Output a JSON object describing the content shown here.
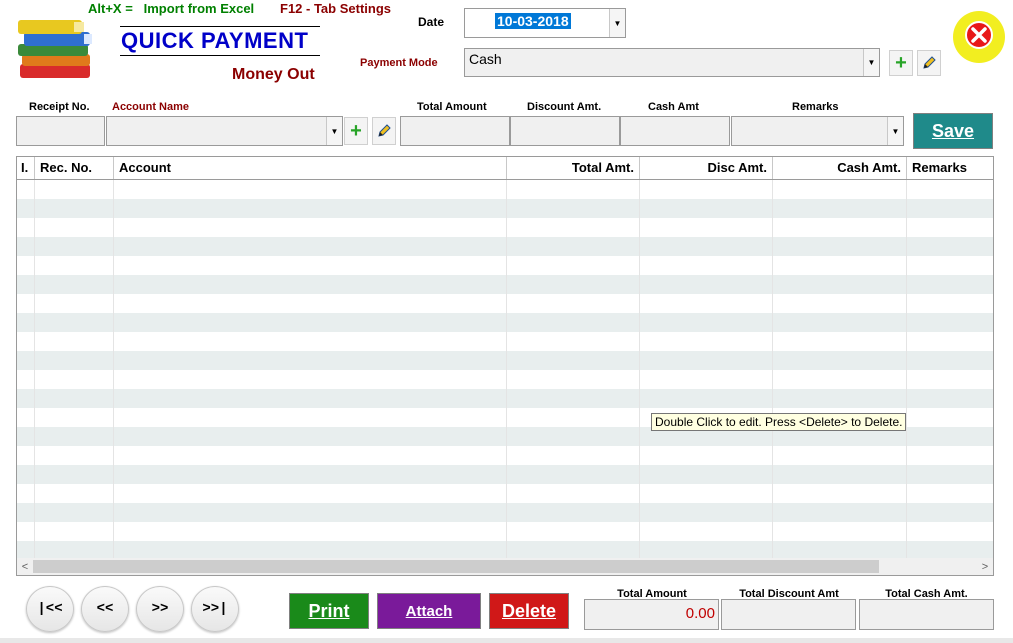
{
  "header": {
    "shortcut_excel_key": "Alt+X =",
    "shortcut_excel_label": "Import from Excel",
    "shortcut_tab": "F12 - Tab Settings",
    "title": "QUICK PAYMENT",
    "subtitle": "Money Out"
  },
  "date": {
    "label": "Date",
    "value": "10-03-2018"
  },
  "payment_mode": {
    "label": "Payment Mode",
    "value": "Cash"
  },
  "entry": {
    "receipt_label": "Receipt No.",
    "account_label": "Account Name",
    "total_label": "Total Amount",
    "discount_label": "Discount Amt.",
    "cash_label": "Cash Amt",
    "remarks_label": "Remarks",
    "receipt_value": "",
    "account_value": "",
    "total_value": "",
    "discount_value": "",
    "cash_value": "",
    "remarks_value": ""
  },
  "save_label": "Save",
  "grid": {
    "columns": [
      "I.",
      "Rec. No.",
      "Account",
      "Total Amt.",
      "Disc Amt.",
      "Cash Amt.",
      "Remarks"
    ],
    "rows": [],
    "tooltip": "Double Click to edit.  Press <Delete> to Delete."
  },
  "nav": {
    "first": "|<<",
    "prev": "<<",
    "next": ">>",
    "last": ">>|"
  },
  "actions": {
    "print": "Print",
    "attach": "Attach",
    "delete": "Delete"
  },
  "totals": {
    "total_amount_label": "Total Amount",
    "total_amount_value": "0.00",
    "total_discount_label": "Total Discount Amt",
    "total_discount_value": "",
    "total_cash_label": "Total Cash Amt.",
    "total_cash_value": ""
  },
  "colors": {
    "title_blue": "#0000c8",
    "label_red": "#8b0000",
    "shortcut_green": "#008000",
    "save_teal": "#1f8a8a",
    "print_green": "#1a8a1a",
    "attach_purple": "#7a1a9a",
    "delete_red": "#d01818",
    "row_alt": "#e8eeee"
  },
  "icons": {
    "logo": "books-stack-icon",
    "close": "close-circle-icon",
    "add": "plus-icon",
    "edit": "pencil-icon",
    "dropdown": "chevron-down-icon"
  }
}
